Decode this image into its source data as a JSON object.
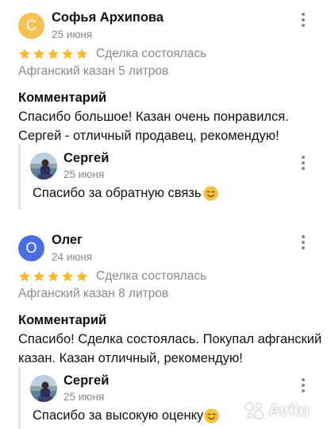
{
  "reviews": [
    {
      "avatar_letter": "С",
      "avatar_color": "#f4c153",
      "author": "Софья Архипова",
      "date": "25 июня",
      "rating": 5,
      "deal_status": "Сделка состоялась",
      "product": "Афганский казан 5 литров",
      "comment_heading": "Комментарий",
      "comment_text": "Спасибо большое! Казан очень понравился. Сергей - отличный продавец, рекомендую!",
      "reply": {
        "name": "Сергей",
        "date": "25 июня",
        "text": "Спасибо за обратную связь"
      }
    },
    {
      "avatar_letter": "О",
      "avatar_color": "#4a6fe0",
      "author": "Олег",
      "date": "24 июня",
      "rating": 5,
      "deal_status": "Сделка состоялась",
      "product": "Афганский казан 8 литров",
      "comment_heading": "Комментарий",
      "comment_text": "Спасибо! Сделка состоялась. Покупал афганский казан. Казан отличный, рекомендую!",
      "reply": {
        "name": "Сергей",
        "date": "25 июня",
        "text": "Спасибо за высокую оценку"
      }
    }
  ],
  "star_color": "#f7b928",
  "watermark": "Avito"
}
